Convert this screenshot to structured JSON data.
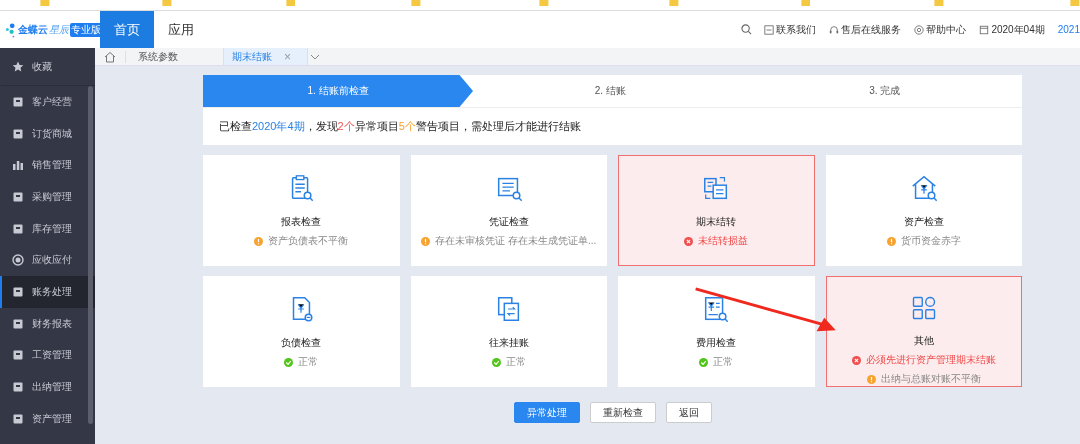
{
  "header": {
    "logo_text": "金蝶云",
    "logo_sub": "星辰",
    "edition": "专业版",
    "nav": [
      {
        "label": "首页",
        "selected": true
      },
      {
        "label": "应用",
        "selected": false
      }
    ],
    "links": [
      "联系我们",
      "售后在线服务",
      "帮助中心"
    ],
    "period": "2020年04期",
    "year": "2021"
  },
  "tabs": [
    {
      "label": "系统参数",
      "selected": false,
      "closable": false
    },
    {
      "label": "期末结账",
      "selected": true,
      "closable": true
    }
  ],
  "tab_close": "×",
  "sidebar": [
    {
      "label": "收藏",
      "selected": false
    },
    {
      "label": "客户经营",
      "selected": false
    },
    {
      "label": "订货商城",
      "selected": false
    },
    {
      "label": "销售管理",
      "selected": false
    },
    {
      "label": "采购管理",
      "selected": false
    },
    {
      "label": "库存管理",
      "selected": false
    },
    {
      "label": "应收应付",
      "selected": false
    },
    {
      "label": "账务处理",
      "selected": true
    },
    {
      "label": "财务报表",
      "selected": false
    },
    {
      "label": "工资管理",
      "selected": false
    },
    {
      "label": "出纳管理",
      "selected": false
    },
    {
      "label": "资产管理",
      "selected": false
    }
  ],
  "steps": [
    {
      "label": "1. 结账前检查",
      "selected": true
    },
    {
      "label": "2. 结账",
      "selected": false
    },
    {
      "label": "3. 完成",
      "selected": false
    }
  ],
  "summary": [
    {
      "text": "已检查",
      "kind": "plain"
    },
    {
      "text": "2020年4期",
      "kind": "period"
    },
    {
      "text": "，发现",
      "kind": "plain"
    },
    {
      "text": "2个",
      "kind": "error"
    },
    {
      "text": "异常项目",
      "kind": "plain"
    },
    {
      "text": "5个",
      "kind": "warning"
    },
    {
      "text": "警告项目，需处理后才能进行结账",
      "kind": "plain"
    }
  ],
  "cards": [
    {
      "title": "报表检查",
      "failed": false,
      "issues": [
        {
          "kind": "warning",
          "text": "资产负债表不平衡"
        }
      ]
    },
    {
      "title": "凭证检查",
      "failed": false,
      "issues": [
        {
          "kind": "warning",
          "text": "存在未审核凭证 存在未生成凭证单..."
        }
      ]
    },
    {
      "title": "期末结转",
      "failed": true,
      "issues": [
        {
          "kind": "error",
          "text": "未结转损益"
        }
      ]
    },
    {
      "title": "资产检查",
      "failed": false,
      "issues": [
        {
          "kind": "warning",
          "text": "货币资金赤字"
        }
      ]
    },
    {
      "title": "负债检查",
      "failed": false,
      "issues": [
        {
          "kind": "ok",
          "text": "正常"
        }
      ]
    },
    {
      "title": "往来挂账",
      "failed": false,
      "issues": [
        {
          "kind": "ok",
          "text": "正常"
        }
      ]
    },
    {
      "title": "费用检查",
      "failed": false,
      "issues": [
        {
          "kind": "ok",
          "text": "正常"
        }
      ]
    },
    {
      "title": "其他",
      "failed": true,
      "issues": [
        {
          "kind": "error",
          "text": "必须先进行资产管理期末结账"
        },
        {
          "kind": "warning",
          "text": "出纳与总账对账不平衡"
        }
      ]
    }
  ],
  "buttons": [
    {
      "label": "异常处理",
      "kind": "primary"
    },
    {
      "label": "重新检查",
      "kind": "default"
    },
    {
      "label": "返回",
      "kind": "default"
    }
  ]
}
